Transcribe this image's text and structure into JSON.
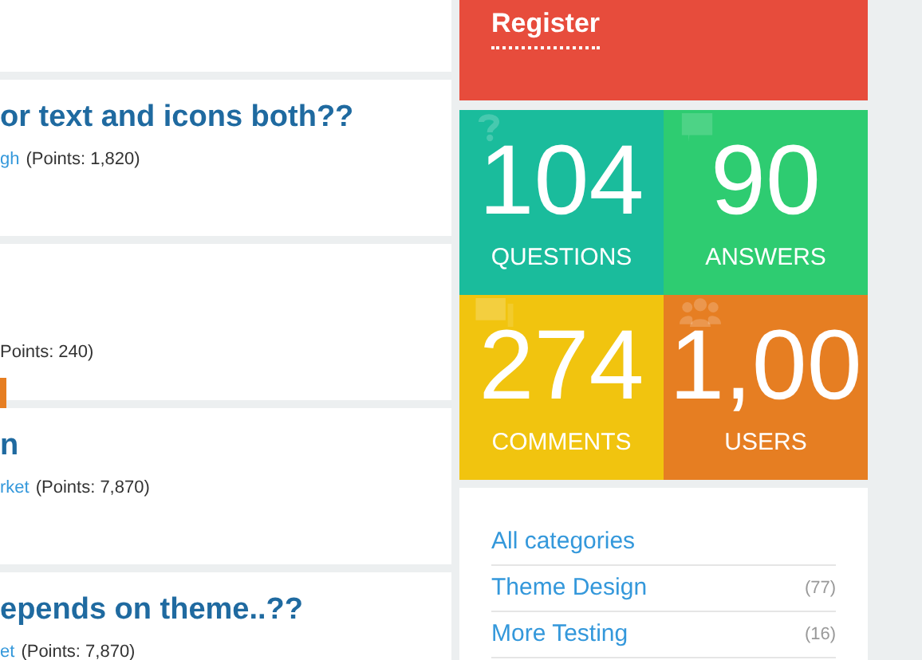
{
  "questions": [
    {
      "kind": "plain",
      "title": "or text and icons both??",
      "author": "gh",
      "points": "(Points: 1,820)"
    },
    {
      "kind": "with_button",
      "points": "Points: 240)"
    },
    {
      "kind": "plain",
      "title": "n",
      "author": "rket",
      "points": "(Points: 7,870)"
    },
    {
      "kind": "plain",
      "title": "epends on theme..??",
      "author": "et",
      "points": "(Points: 7,870)"
    }
  ],
  "register": {
    "label": "Register"
  },
  "stats": [
    {
      "kind": "questions",
      "value": "104",
      "label": "QUESTIONS",
      "color": "#1abc9c"
    },
    {
      "kind": "answers",
      "value": "90",
      "label": "ANSWERS",
      "color": "#2ecc71"
    },
    {
      "kind": "comments",
      "value": "274",
      "label": "COMMENTS",
      "color": "#f1c40f"
    },
    {
      "kind": "users",
      "value": "1,00",
      "label": "USERS",
      "color": "#e67e22"
    }
  ],
  "categories": [
    {
      "label": "All categories"
    },
    {
      "label": "Theme Design",
      "count": "(77)"
    },
    {
      "label": "More Testing",
      "count": "(16)"
    }
  ]
}
